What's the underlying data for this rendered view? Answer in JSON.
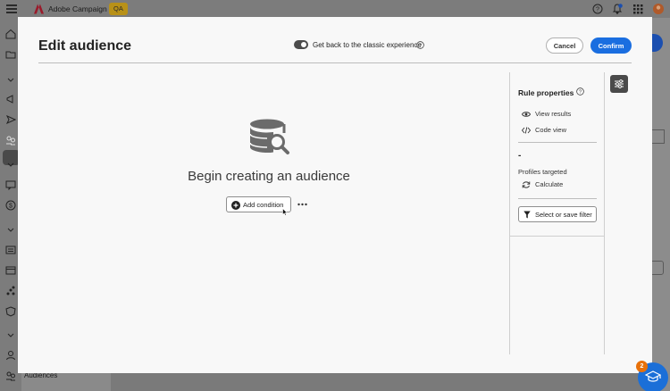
{
  "app": {
    "title": "Adobe Campaign",
    "env_badge": "QA",
    "footer_label": "Audiences"
  },
  "modal": {
    "title": "Edit audience",
    "toggle_label": "Get back to the classic experience",
    "toggle_on": true,
    "cancel_label": "Cancel",
    "confirm_label": "Confirm"
  },
  "canvas": {
    "empty_title": "Begin creating an audience",
    "add_condition_label": "Add condition"
  },
  "rule_panel": {
    "title": "Rule properties",
    "view_results_label": "View results",
    "code_view_label": "Code view",
    "profiles_value": "-",
    "profiles_label": "Profiles targeted",
    "calculate_label": "Calculate",
    "filter_label": "Select or save filter"
  },
  "learn": {
    "badge_count": "2"
  },
  "colors": {
    "primary": "#1a6ee0",
    "badge_orange": "#e8710a",
    "env_badge": "#b89118",
    "adobe_red": "#c4122f"
  }
}
